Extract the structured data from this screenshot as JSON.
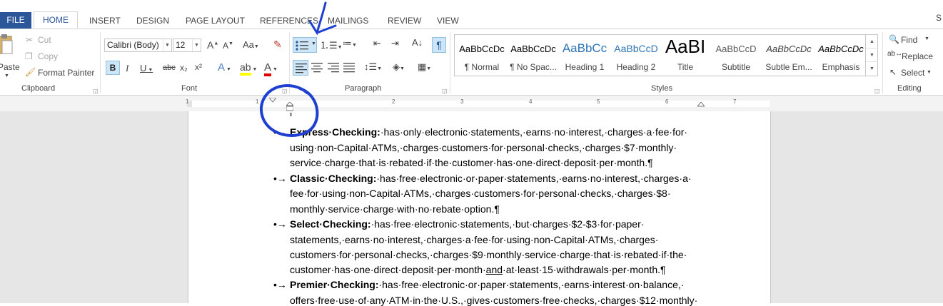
{
  "tabs": [
    "FILE",
    "HOME",
    "INSERT",
    "DESIGN",
    "PAGE LAYOUT",
    "REFERENCES",
    "MAILINGS",
    "REVIEW",
    "VIEW"
  ],
  "user_initial": "S",
  "clipboard": {
    "paste": "Paste",
    "cut": "Cut",
    "copy": "Copy",
    "format_painter": "Format Painter",
    "label": "Clipboard"
  },
  "font": {
    "name": "Calibri (Body)",
    "size": "12",
    "change_case": "Aa",
    "label": "Font",
    "strikethrough": "abc",
    "subscript": "x₂",
    "superscript": "x²"
  },
  "paragraph": {
    "label": "Paragraph"
  },
  "styles": {
    "label": "Styles",
    "items": [
      {
        "sample": "AaBbCcDc",
        "name": "¶ Normal"
      },
      {
        "sample": "AaBbCcDc",
        "name": "¶ No Spac..."
      },
      {
        "sample": "AaBbCc",
        "name": "Heading 1"
      },
      {
        "sample": "AaBbCcD",
        "name": "Heading 2"
      },
      {
        "sample": "AaBI",
        "name": "Title"
      },
      {
        "sample": "AaBbCcD",
        "name": "Subtitle"
      },
      {
        "sample": "AaBbCcDc",
        "name": "Subtle Em..."
      },
      {
        "sample": "AaBbCcDc",
        "name": "Emphasis"
      }
    ],
    "colors": {
      "heading": "#2e74b5",
      "subtitle": "#5a5a5a"
    }
  },
  "editing": {
    "find": "Find",
    "replace": "Replace",
    "select": "Select",
    "label": "Editing"
  },
  "ruler": {
    "ticks": [
      "1",
      "1",
      "2",
      "3",
      "4",
      "5",
      "6",
      "7"
    ]
  },
  "document": {
    "lines": [
      {
        "bold": "Express·Checking:",
        "text": "·has·only·electronic·statements,·earns·no·interest,·charges·a·fee·for·",
        "bullet": true
      },
      {
        "text": "using·non-Capital·ATMs,·charges·customers·for·personal·checks,·charges·$7·monthly·"
      },
      {
        "text": "service·charge·that·is·rebated·if·the·customer·has·one·direct·deposit·per·month.¶"
      },
      {
        "bold": "Classic·Checking:",
        "text": "·has·free·electronic·or·paper·statements,·earns·no·interest,·charges·a·",
        "bullet": true
      },
      {
        "text": "fee·for·using·non-Capital·ATMs,·charges·customers·for·personal·checks,·charges·$8·"
      },
      {
        "text": "monthly·service·charge·with·no·rebate·option.¶"
      },
      {
        "bold": "Select·Checking:",
        "text": "·has·free·electronic·statements,·but·charges·$2-$3·for·paper·",
        "bullet": true
      },
      {
        "text": "statements,·earns·no·interest,·charges·a·fee·for·using·non-Capital·ATMs,·charges·"
      },
      {
        "text": "customers·for·personal·checks,·charges·$9·monthly·service·charge·that·is·rebated·if·the·"
      },
      {
        "text_pre": "customer·has·one·direct·deposit·per·month·",
        "underline": "and",
        "text": "·at·least·15·withdrawals·per·month.¶"
      },
      {
        "bold": "Premier·Checking:",
        "text": "·has·free·electronic·or·paper·statements,·earns·interest·on·balance,·",
        "bullet": true
      },
      {
        "text": "offers·free·use·of·any·ATM·in·the·U.S.,·gives·customers·free·checks,·charges·$12·monthly·"
      }
    ],
    "bullet_glyph": "•→",
    "cut_line": "r"
  },
  "annotation_color": "#1f3fd1"
}
